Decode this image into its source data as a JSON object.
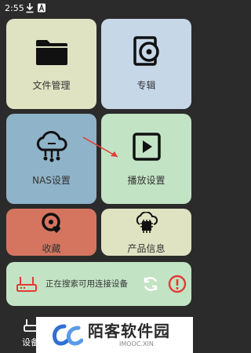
{
  "status_bar": {
    "time": "2:55"
  },
  "tiles": {
    "files": "文件管理",
    "albums": "专辑",
    "nas": "NAS设置",
    "play": "播放设置",
    "favorites": "收藏",
    "product_info": "产品信息"
  },
  "search": {
    "status_text": "正在搜索可用连接设备"
  },
  "bottom_nav": {
    "device_label": "设备"
  },
  "watermark": {
    "title": "陌客软件园",
    "subtitle": "IMOOC.XIN"
  },
  "colors": {
    "background": "#2b2b2b",
    "files_tile": "#dfe3c2",
    "albums_tile": "#c6d7e8",
    "nas_tile": "#8fb3c8",
    "play_tile": "#c2e3c4",
    "favorites_tile": "#d57560",
    "product_info_tile": "#dfe3c2",
    "alert_red": "#e53935",
    "arrow_red": "#e53935"
  },
  "icons": {
    "files": "folder-icon",
    "albums": "album-disc-icon",
    "nas": "cloud-network-icon",
    "play": "play-icon",
    "favorites": "favorite-disc-icon",
    "product_info": "chip-cloud-icon",
    "refresh": "refresh-icon",
    "alert": "alert-icon"
  }
}
